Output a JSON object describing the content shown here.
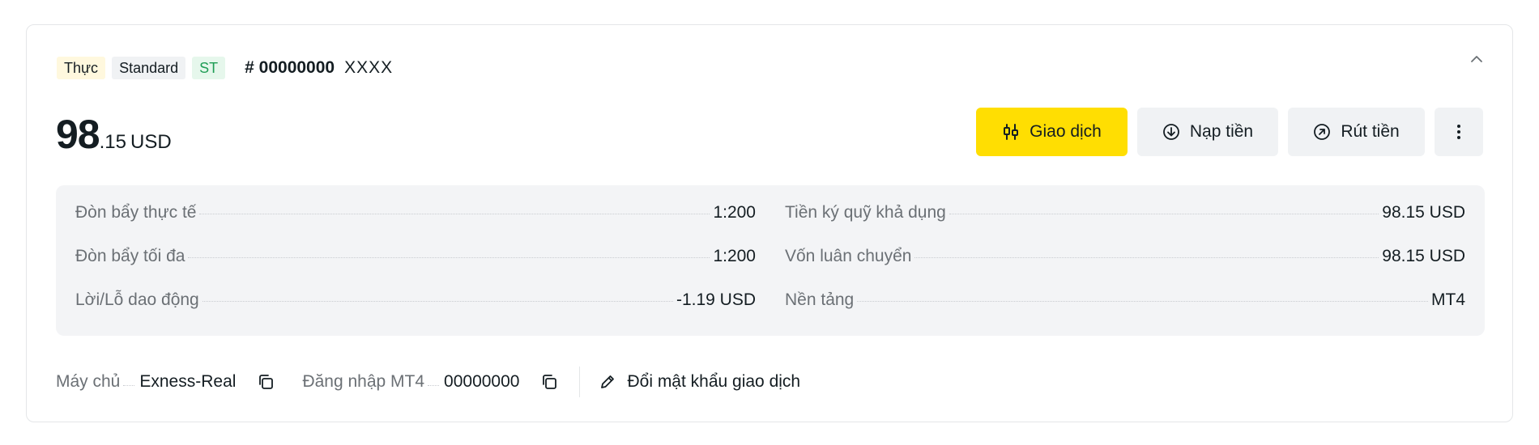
{
  "account": {
    "badges": {
      "real": "Thực",
      "type": "Standard",
      "code": "ST"
    },
    "number": "# 00000000",
    "name": "XXXX"
  },
  "balance": {
    "integer": "98",
    "fraction": ".15",
    "currency": "USD"
  },
  "actions": {
    "trade_label": "Giao dịch",
    "deposit_label": "Nạp tiền",
    "withdraw_label": "Rút tiền"
  },
  "details": {
    "left": [
      {
        "label": "Đòn bẩy thực tế",
        "value": "1:200"
      },
      {
        "label": "Đòn bẩy tối đa",
        "value": "1:200"
      },
      {
        "label": "Lời/Lỗ dao động",
        "value": "-1.19 USD"
      }
    ],
    "right": [
      {
        "label": "Tiền ký quỹ khả dụng",
        "value": "98.15 USD"
      },
      {
        "label": "Vốn luân chuyển",
        "value": "98.15 USD"
      },
      {
        "label": "Nền tảng",
        "value": "MT4"
      }
    ]
  },
  "footer": {
    "server_label": "Máy chủ",
    "server_value": "Exness-Real",
    "login_label": "Đăng nhập MT4",
    "login_value": "00000000",
    "change_password_label": "Đổi mật khẩu giao dịch"
  },
  "colors": {
    "primary": "#ffde02",
    "card_bg": "#f3f4f6",
    "muted_text": "#6b7075",
    "badge_st": "#1f9d55"
  },
  "icons": [
    "chevron-up-icon",
    "candlestick-icon",
    "arrow-down-circle-icon",
    "arrow-up-right-circle-icon",
    "more-vertical-icon",
    "copy-icon",
    "pencil-icon"
  ]
}
